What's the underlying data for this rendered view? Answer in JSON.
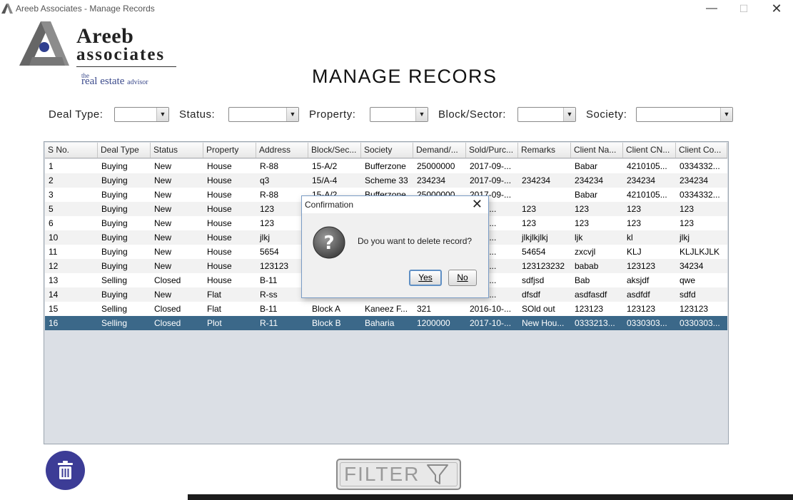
{
  "window": {
    "title": "Areeb Associates - Manage Records",
    "min_glyph": "—",
    "max_glyph": "☐",
    "close_glyph": "✕"
  },
  "logo": {
    "word1": "Areeb",
    "word2": "associates",
    "the": "the",
    "tagline_main": "real estate",
    "tagline_small": "advisor"
  },
  "page_title": "MANAGE RECORS",
  "filters": {
    "deal_type_label": "Deal Type:",
    "status_label": "Status:",
    "property_label": "Property:",
    "block_label": "Block/Sector:",
    "society_label": "Society:",
    "dropdown_arrow": "▼"
  },
  "table": {
    "columns": [
      "S No.",
      "Deal Type",
      "Status",
      "Property",
      "Address",
      "Block/Sec...",
      "Society",
      "Demand/...",
      "Sold/Purc...",
      "Remarks",
      "Client Na...",
      "Client CN...",
      "Client Co..."
    ],
    "rows": [
      [
        "1",
        "Buying",
        "New",
        "House",
        "R-88",
        "15-A/2",
        "Bufferzone",
        "25000000",
        "2017-09-...",
        "",
        "Babar",
        "4210105...",
        "0334332..."
      ],
      [
        "2",
        "Buying",
        "New",
        "House",
        "q3",
        "15/A-4",
        "Scheme 33",
        "234234",
        "2017-09-...",
        "234234",
        "234234",
        "234234",
        "234234"
      ],
      [
        "3",
        "Buying",
        "New",
        "House",
        "R-88",
        "15-A/2",
        "Bufferzone",
        "25000000",
        "2017-09-...",
        "",
        "Babar",
        "4210105...",
        "0334332..."
      ],
      [
        "5",
        "Buying",
        "New",
        "House",
        "123",
        "",
        "",
        "",
        "...09-...",
        "123",
        "123",
        "123",
        "123"
      ],
      [
        "6",
        "Buying",
        "New",
        "House",
        "123",
        "",
        "",
        "",
        "...09-...",
        "123",
        "123",
        "123",
        "123"
      ],
      [
        "10",
        "Buying",
        "New",
        "House",
        "jlkj",
        "",
        "",
        "",
        "...09-...",
        "jlkjlkjlkj",
        "ljk",
        "kl",
        "jlkj"
      ],
      [
        "11",
        "Buying",
        "New",
        "House",
        "5654",
        "",
        "",
        "",
        "...09-...",
        "54654",
        "zxcvjl",
        "KLJ",
        "KLJLKJLK"
      ],
      [
        "12",
        "Buying",
        "New",
        "House",
        "123123",
        "",
        "",
        "",
        "...09-...",
        "123123232",
        "babab",
        "123123",
        "34234"
      ],
      [
        "13",
        "Selling",
        "Closed",
        "House",
        "B-11",
        "",
        "",
        "",
        "...09-...",
        "sdfjsd",
        "Bab",
        "aksjdf",
        "qwe"
      ],
      [
        "14",
        "Buying",
        "New",
        "Flat",
        "R-ss",
        "",
        "",
        "",
        "...09-...",
        "dfsdf",
        "asdfasdf",
        "asdfdf",
        "sdfd"
      ],
      [
        "15",
        "Selling",
        "Closed",
        "Flat",
        "B-11",
        "Block A",
        "Kaneez F...",
        "321",
        "2016-10-...",
        "SOld out",
        "123123",
        "123123",
        "123123"
      ],
      [
        "16",
        "Selling",
        "Closed",
        "Plot",
        "R-11",
        "Block B",
        "Baharia",
        "1200000",
        "2017-10-...",
        "New Hou...",
        "0333213...",
        "0330303...",
        "0330303..."
      ]
    ],
    "selected_row_index": 11
  },
  "dialog": {
    "title": "Confirmation",
    "message": "Do you want to delete record?",
    "yes_label": "Yes",
    "no_label": "No",
    "close_glyph": "✕"
  },
  "filter_button": {
    "label": "FILTER"
  },
  "icons": {
    "app": "areeb-logo-icon",
    "delete": "trash-icon",
    "question": "question-icon",
    "filter": "funnel-icon"
  },
  "colors": {
    "selected_row": "#3b6889",
    "delete_button": "#3c3c96",
    "brand_blue": "#3b4a8c",
    "dialog_border": "#7a9cc5"
  }
}
